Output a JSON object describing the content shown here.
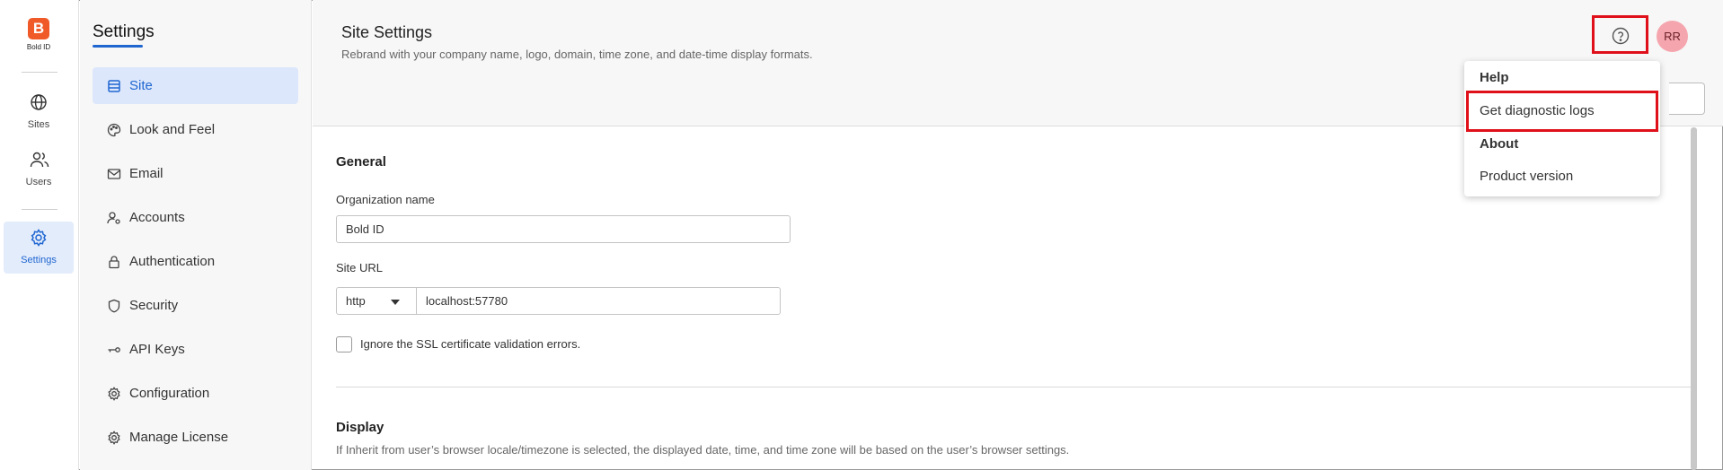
{
  "brand": {
    "logo_letter": "B",
    "name": "Bold ID",
    "color": "#f05a28"
  },
  "rail": {
    "items": [
      {
        "label": "Sites",
        "icon": "globe-icon"
      },
      {
        "label": "Users",
        "icon": "users-icon"
      },
      {
        "label": "Settings",
        "icon": "gear-icon",
        "active": true
      }
    ]
  },
  "sidebar": {
    "title": "Settings",
    "items": [
      {
        "label": "Site",
        "icon": "server-icon",
        "active": true
      },
      {
        "label": "Look and Feel",
        "icon": "palette-icon"
      },
      {
        "label": "Email",
        "icon": "mail-icon"
      },
      {
        "label": "Accounts",
        "icon": "user-settings-icon"
      },
      {
        "label": "Authentication",
        "icon": "lock-icon"
      },
      {
        "label": "Security",
        "icon": "shield-icon"
      },
      {
        "label": "API Keys",
        "icon": "key-icon"
      },
      {
        "label": "Configuration",
        "icon": "gear-icon"
      },
      {
        "label": "Manage License",
        "icon": "gear-icon"
      }
    ]
  },
  "header": {
    "title": "Site Settings",
    "subtitle": "Rebrand with your company name, logo, domain, time zone, and date-time display formats.",
    "avatar_initials": "RR",
    "help_icon": "help-circle-icon"
  },
  "help_menu": {
    "help_heading": "Help",
    "diagnostic_logs": "Get diagnostic logs",
    "about_heading": "About",
    "product_version": "Product version"
  },
  "general": {
    "title": "General",
    "org_label": "Organization name",
    "org_value": "Bold ID",
    "site_url_label": "Site URL",
    "protocol": "http",
    "host": "localhost:57780",
    "ssl_label": "Ignore the SSL certificate validation errors."
  },
  "display": {
    "title": "Display",
    "description": "If Inherit from user’s browser locale/timezone is selected, the displayed date, time, and time zone will be based on the user’s browser settings."
  },
  "colors": {
    "accent": "#1f66d1",
    "highlight": "#e0101b",
    "avatar": "#f5a5ad"
  }
}
